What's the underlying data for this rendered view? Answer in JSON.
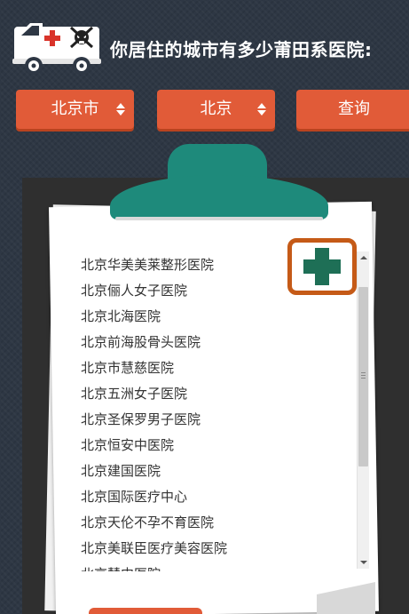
{
  "header": {
    "title": "你居住的城市有多少莆田系医院:",
    "logo_icon": "ambulance-skull-icon"
  },
  "controls": {
    "city_select": "北京市",
    "district_select": "北京",
    "query_button": "查询"
  },
  "hospitals": [
    "北京华美美莱整形医院",
    "北京俪人女子医院",
    "北京北海医院",
    "北京前海股骨头医院",
    "北京市慧慈医院",
    "北京五洲女子医院",
    "北京圣保罗男子医院",
    "北京恒安中医院",
    "北京建国医院",
    "北京国际医疗中心",
    "北京天伦不孕不育医院",
    "北京美联臣医疗美容医院",
    "北京慧中医院"
  ],
  "colors": {
    "background": "#2e3744",
    "accent_orange": "#e15b38",
    "clip_teal": "#1e8a7b",
    "cross_green": "#1e6f56",
    "badge_border": "#c55a17"
  }
}
